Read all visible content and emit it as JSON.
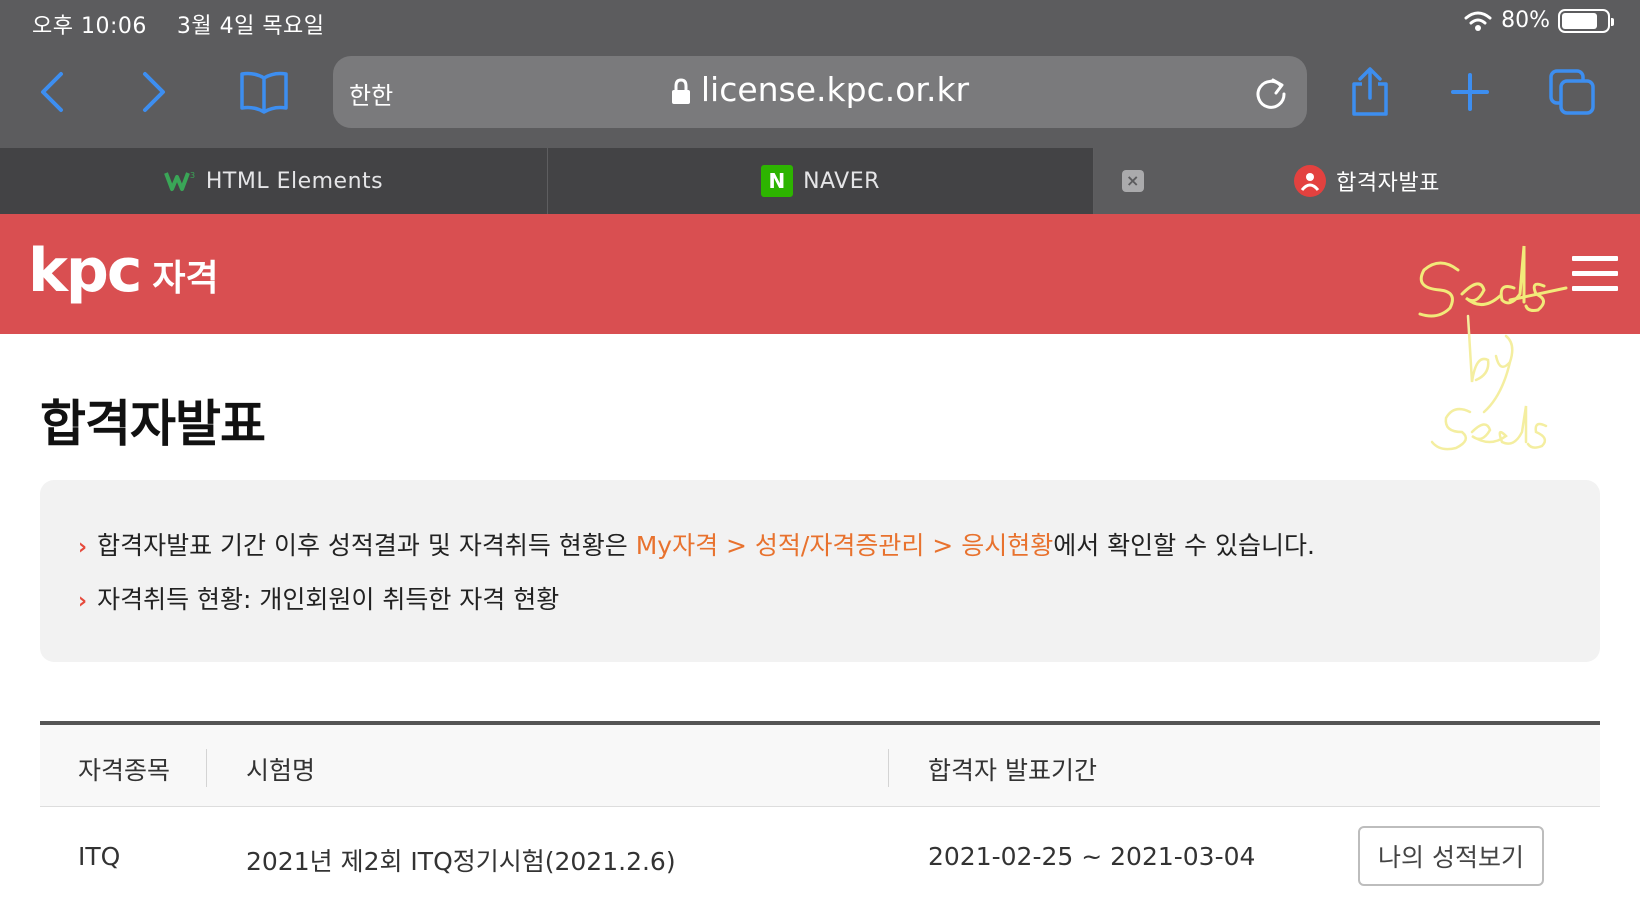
{
  "status": {
    "time": "오후 10:06",
    "date": "3월 4일 목요일",
    "battery": "80%",
    "battery_level": 0.8
  },
  "browser": {
    "lang_toggle": "한한",
    "url": "license.kpc.or.kr",
    "tabs": [
      {
        "label": "HTML Elements",
        "active": false
      },
      {
        "label": "NAVER",
        "active": false
      },
      {
        "label": "합격자발표",
        "active": true
      }
    ]
  },
  "site": {
    "logo": "kpc",
    "logo_sub": "자격"
  },
  "page": {
    "title": "합격자발표",
    "notices": [
      {
        "before": "합격자발표 기간 이후 성적결과 및 자격취득 현황은 ",
        "highlight": "My자격 > 성적/자격증관리 > 응시현황",
        "after": "에서 확인할 수 있습니다."
      },
      {
        "before": "자격취득 현황: 개인회원이 취득한 자격 현황",
        "highlight": "",
        "after": ""
      }
    ],
    "table": {
      "headers": [
        "자격종목",
        "시험명",
        "합격자 발표기간"
      ],
      "rows": [
        {
          "item": "ITQ",
          "exam": "2021년 제2회 ITQ정기시험(2021.2.6)",
          "period": "2021-02-25 ~ 2021-03-04",
          "action": "나의 성적보기"
        }
      ]
    }
  },
  "colors": {
    "header_red": "#d94f51",
    "link_orange": "#e8722e",
    "browser_blue": "#3d8ef0"
  },
  "icons": [
    "back-icon",
    "forward-icon",
    "bookmarks-icon",
    "lock-icon",
    "reload-icon",
    "share-icon",
    "new-tab-icon",
    "tabs-icon",
    "wifi-icon",
    "battery-icon",
    "close-icon",
    "menu-icon"
  ]
}
